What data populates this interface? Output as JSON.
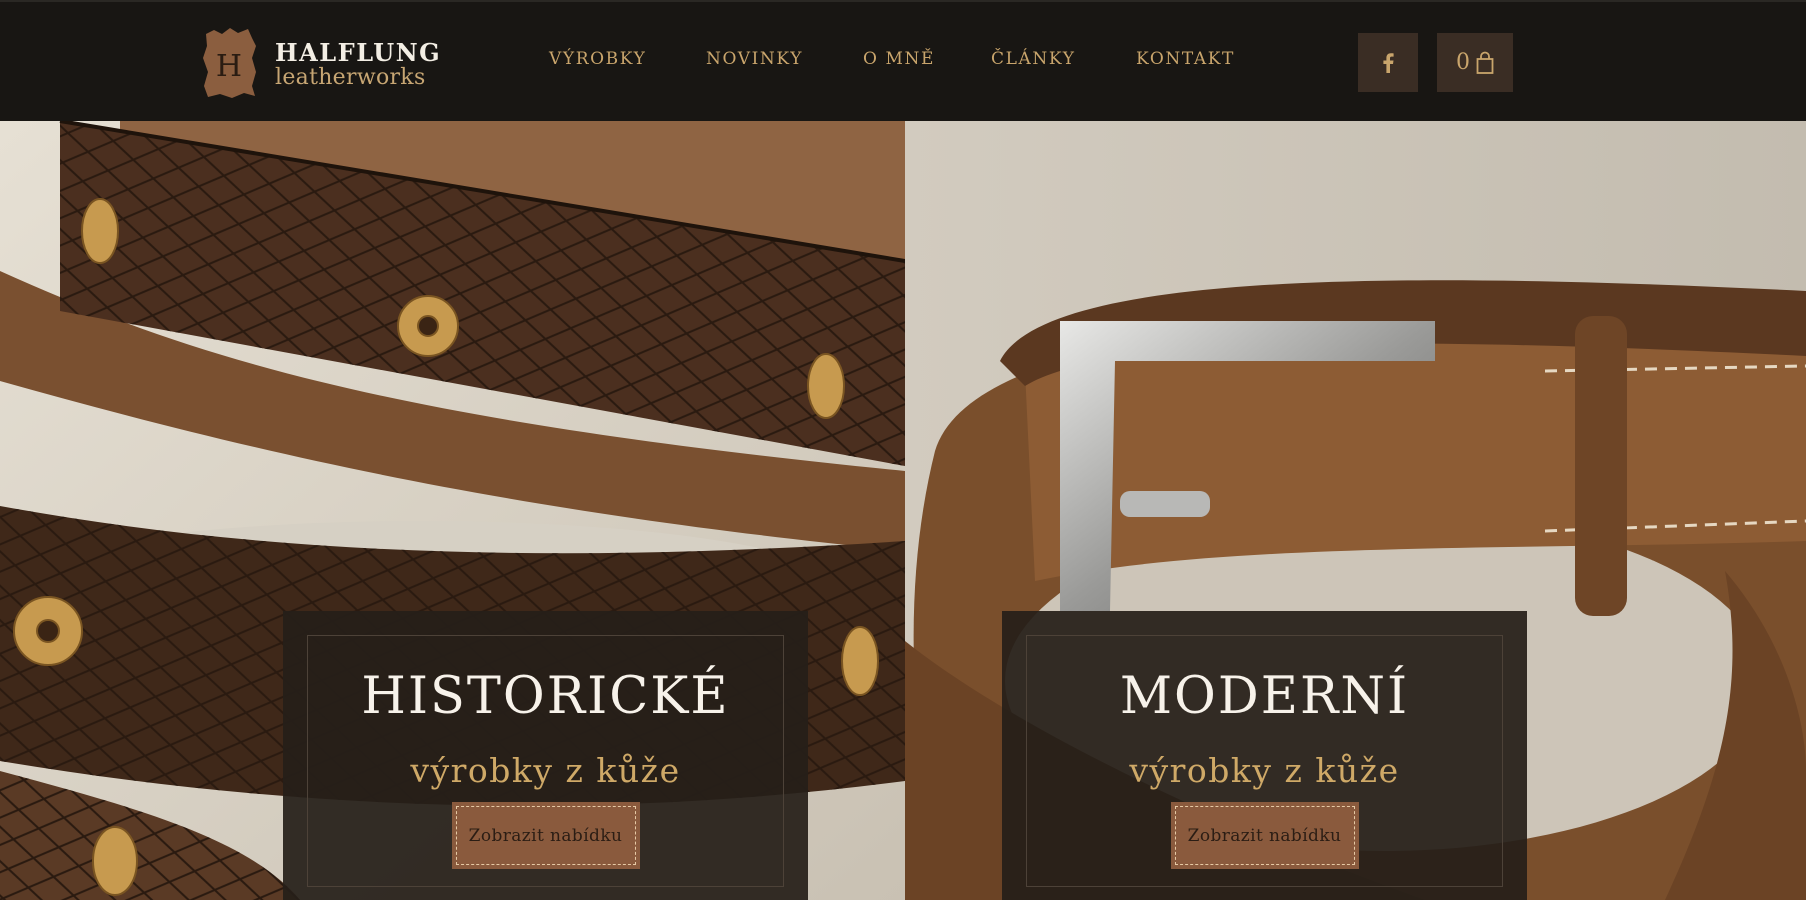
{
  "brand": {
    "mark_letter": "H",
    "title": "HALFLUNG",
    "subtitle": "leatherworks"
  },
  "nav": {
    "items": [
      {
        "label": "VÝROBKY"
      },
      {
        "label": "NOVINKY"
      },
      {
        "label": "O MNĚ"
      },
      {
        "label": "ČLÁNKY"
      },
      {
        "label": "KONTAKT"
      }
    ]
  },
  "social": {
    "icon": "facebook-icon"
  },
  "cart": {
    "count": "0",
    "icon": "shopping-bag-icon"
  },
  "hero": {
    "cards": [
      {
        "title": "HISTORICKÉ",
        "subtitle": "výrobky z kůže",
        "button": "Zobrazit nabídku",
        "image": "decorated-historic-leather-belts-photo"
      },
      {
        "title": "MODERNÍ",
        "subtitle": "výrobky z kůže",
        "button": "Zobrazit nabídku",
        "image": "modern-leather-belt-with-steel-buckle-photo"
      }
    ]
  },
  "colors": {
    "header_bg": "#181613",
    "accent_gold": "#c9a56c",
    "button_brown": "#8a5a3d",
    "card_bg": "#261f19"
  }
}
